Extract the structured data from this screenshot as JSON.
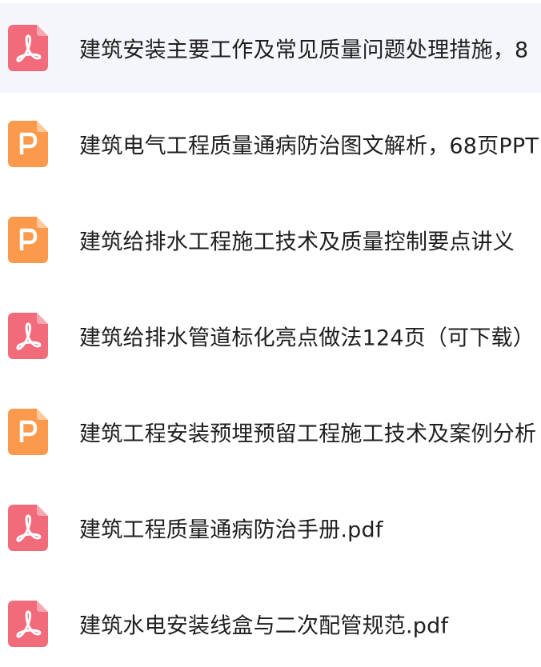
{
  "files": [
    {
      "type": "pdf",
      "icon": "pdf-icon",
      "name": "建筑安装主要工作及常见质量问题处理措施，8"
    },
    {
      "type": "ppt",
      "icon": "ppt-icon",
      "name": "建筑电气工程质量通病防治图文解析，68页PPT"
    },
    {
      "type": "ppt",
      "icon": "ppt-icon",
      "name": "建筑给排水工程施工技术及质量控制要点讲义"
    },
    {
      "type": "pdf",
      "icon": "pdf-icon",
      "name": "建筑给排水管道标化亮点做法124页（可下载）"
    },
    {
      "type": "ppt",
      "icon": "ppt-icon",
      "name": "建筑工程安装预埋预留工程施工技术及案例分析"
    },
    {
      "type": "pdf",
      "icon": "pdf-icon",
      "name": "建筑工程质量通病防治手册.pdf"
    },
    {
      "type": "pdf",
      "icon": "pdf-icon",
      "name": "建筑水电安装线盒与二次配管规范.pdf"
    }
  ],
  "colors": {
    "pdf_icon": "#f26b7a",
    "ppt_icon": "#fb9a4c",
    "highlight_row": "#f4f6fb",
    "text": "#1f1f1f"
  }
}
